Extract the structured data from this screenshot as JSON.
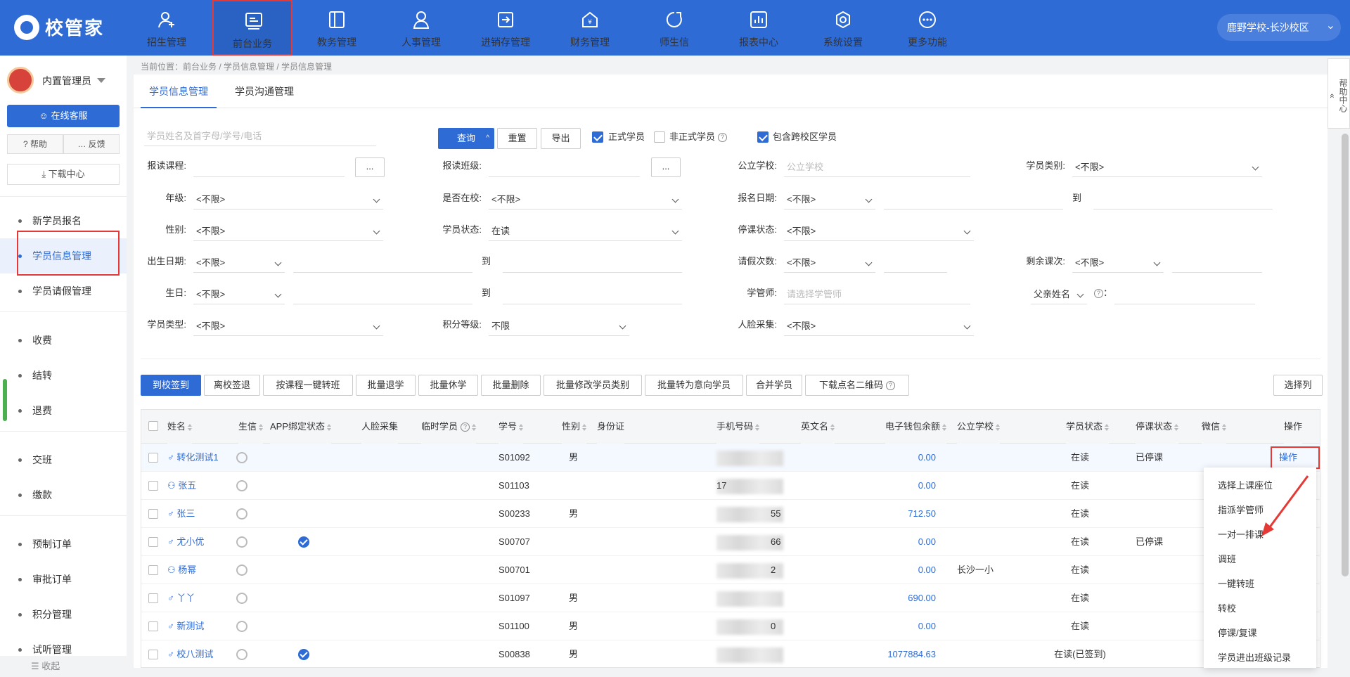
{
  "app": {
    "logo_text": "校管家"
  },
  "topnav": [
    {
      "label": "招生管理",
      "icon": "user-plus-icon"
    },
    {
      "label": "前台业务",
      "icon": "reception-icon",
      "active": true
    },
    {
      "label": "教务管理",
      "icon": "book-icon"
    },
    {
      "label": "人事管理",
      "icon": "person-icon"
    },
    {
      "label": "进销存管理",
      "icon": "inventory-icon"
    },
    {
      "label": "财务管理",
      "icon": "finance-icon"
    },
    {
      "label": "师生信",
      "icon": "chat-icon"
    },
    {
      "label": "报表中心",
      "icon": "report-icon"
    },
    {
      "label": "系统设置",
      "icon": "settings-icon"
    },
    {
      "label": "更多功能",
      "icon": "more-icon"
    }
  ],
  "school": "鹿野学校-长沙校区",
  "sidebar": {
    "admin": "内置管理员",
    "service": "在线客服",
    "help": "帮助",
    "feedback": "反馈",
    "download": "下载中心",
    "items": [
      "新学员报名",
      "学员信息管理",
      "学员请假管理",
      "收费",
      "结转",
      "退费",
      "交班",
      "缴款",
      "预制订单",
      "审批订单",
      "积分管理",
      "试听管理"
    ],
    "collapse": "收起"
  },
  "breadcrumb": "当前位置：前台业务 / 学员信息管理 / 学员信息管理",
  "tabs": [
    "学员信息管理",
    "学员沟通管理"
  ],
  "search": {
    "placeholder": "学员姓名及首字母/学号/电话",
    "query": "查询",
    "reset": "重置",
    "export": "导出",
    "formal": "正式学员",
    "informal": "非正式学员",
    "cross": "包含跨校区学员"
  },
  "filters": {
    "course": "报读课程:",
    "class": "报读班级:",
    "public_school": "公立学校:",
    "public_school_ph": "公立学校",
    "student_type": "学员类别:",
    "grade": "年级:",
    "in_school": "是否在校:",
    "enroll_date": "报名日期:",
    "gender": "性别:",
    "status": "学员状态:",
    "status_val": "在读",
    "suspend": "停课状态:",
    "birth_date": "出生日期:",
    "leave_count": "请假次数:",
    "remaining": "剩余课次:",
    "birthday": "生日:",
    "manager": "学管师:",
    "manager_ph": "请选择学管师",
    "parent": "父亲姓名",
    "student_kind": "学员类型:",
    "points_level": "积分等级:",
    "points_val": "不限",
    "face": "人脸采集:",
    "unlimited": "<不限>",
    "to": "到",
    "colon": "："
  },
  "actions": [
    "到校签到",
    "离校签退",
    "按课程一键转班",
    "批量退学",
    "批量休学",
    "批量删除",
    "批量修改学员类别",
    "批量转为意向学员",
    "合并学员",
    "下载点名二维码",
    "选择列"
  ],
  "columns": [
    "姓名",
    "生信",
    "APP绑定状态",
    "人脸采集",
    "临时学员",
    "学号",
    "性别",
    "身份证",
    "手机号码",
    "英文名",
    "电子钱包余额",
    "公立学校",
    "学员状态",
    "停课状态",
    "微信",
    "操作"
  ],
  "rows": [
    {
      "name": "转化测试1",
      "gender_icon": "male-icon",
      "app": false,
      "id": "S01092",
      "sex": "男",
      "wallet": "0.00",
      "school": "",
      "status": "在读",
      "suspend": "已停课",
      "op": "操作"
    },
    {
      "name": "张五",
      "gender_icon": "person-icon",
      "app": false,
      "id": "S01103",
      "sex": "",
      "wallet": "0.00",
      "school": "",
      "status": "在读",
      "suspend": ""
    },
    {
      "name": "张三",
      "gender_icon": "male-icon",
      "app": false,
      "id": "S00233",
      "sex": "男",
      "wallet": "712.50",
      "school": "",
      "status": "在读",
      "suspend": ""
    },
    {
      "name": "尤小优",
      "gender_icon": "male-icon",
      "app": true,
      "id": "S00707",
      "sex": "",
      "wallet": "0.00",
      "school": "",
      "status": "在读",
      "suspend": "已停课"
    },
    {
      "name": "杨幂",
      "gender_icon": "person-icon",
      "app": false,
      "id": "S00701",
      "sex": "",
      "wallet": "0.00",
      "school": "长沙一小",
      "status": "在读",
      "suspend": ""
    },
    {
      "name": "丫丫",
      "gender_icon": "male-icon",
      "app": false,
      "id": "S01097",
      "sex": "男",
      "wallet": "690.00",
      "school": "",
      "status": "在读",
      "suspend": ""
    },
    {
      "name": "新测试",
      "gender_icon": "male-icon",
      "app": false,
      "id": "S01100",
      "sex": "男",
      "wallet": "0.00",
      "school": "",
      "status": "在读",
      "suspend": ""
    },
    {
      "name": "校八测试",
      "gender_icon": "male-icon",
      "app": true,
      "id": "S00838",
      "sex": "男",
      "wallet": "1077884.63",
      "school": "",
      "status": "在读(已签到)",
      "suspend": ""
    }
  ],
  "phone_fragments": [
    "",
    "17",
    "",
    "",
    "",
    "",
    "",
    ""
  ],
  "phone_tails": [
    "",
    "",
    "55",
    "66",
    "2",
    "",
    "0",
    ""
  ],
  "op_menu": [
    "选择上课座位",
    "指派学管师",
    "一对一排课",
    "调班",
    "一键转班",
    "转校",
    "停课/复课",
    "学员进出班级记录"
  ],
  "help_tab": "帮助中心",
  "colors": {
    "primary": "#2f6bd5",
    "highlight": "#e53935"
  }
}
